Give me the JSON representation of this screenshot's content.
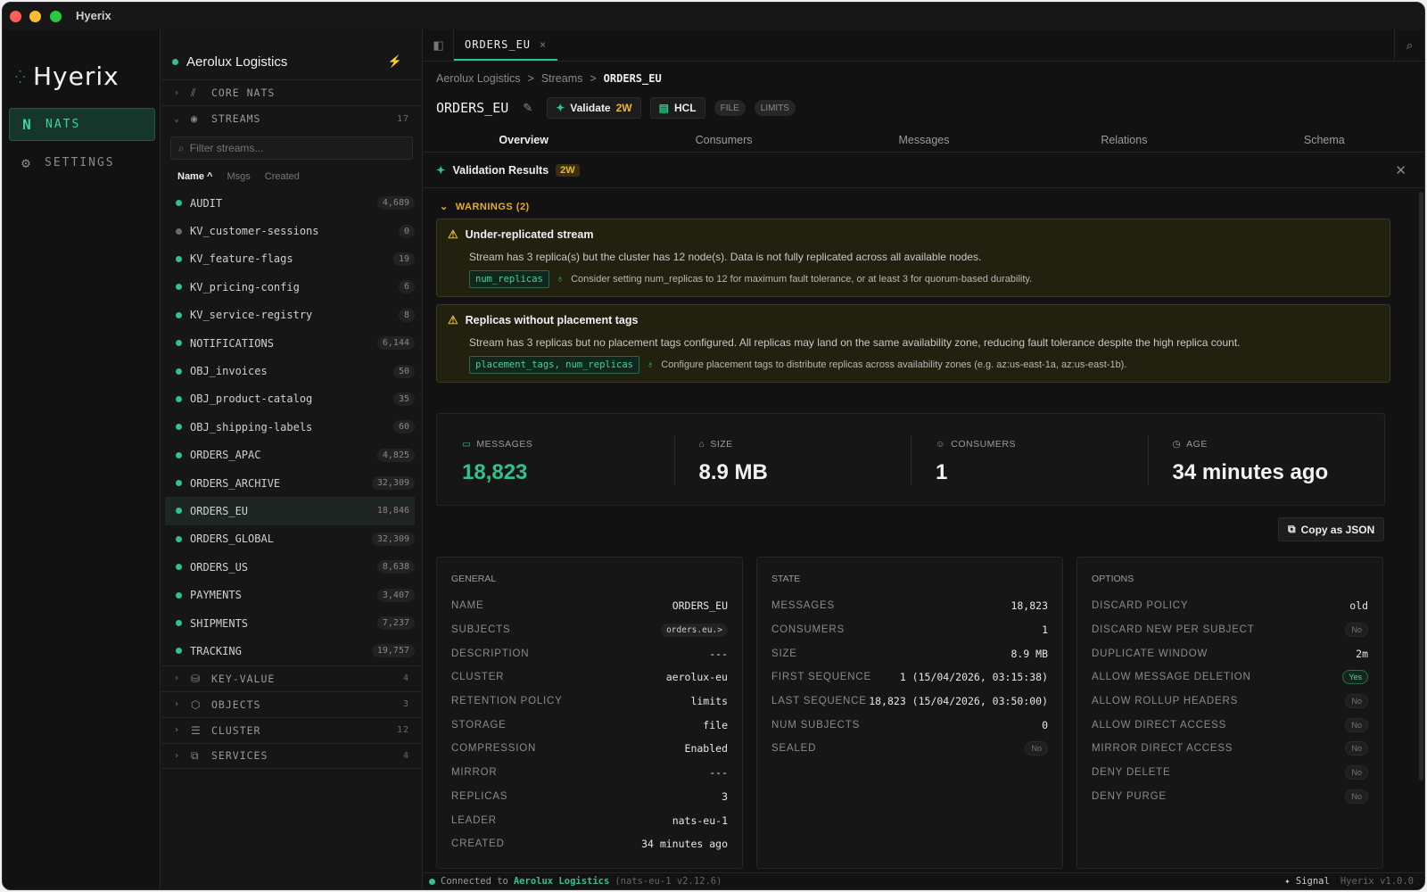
{
  "window": {
    "title": "Hyerix"
  },
  "nav": {
    "logo": "Hyerix",
    "items": [
      {
        "label": "NATS",
        "icon": "nats-n-icon",
        "glyph": "N"
      },
      {
        "label": "SETTINGS",
        "icon": "gear-icon",
        "glyph": "⚙"
      }
    ]
  },
  "sidebar": {
    "connection": "Aerolux Logistics",
    "sections": {
      "core_nats": {
        "label": "CORE NATS"
      },
      "streams": {
        "label": "STREAMS",
        "count": "17"
      },
      "key_value": {
        "label": "KEY-VALUE",
        "count": "4"
      },
      "objects": {
        "label": "OBJECTS",
        "count": "3"
      },
      "cluster": {
        "label": "CLUSTER",
        "count": "12"
      },
      "services": {
        "label": "SERVICES",
        "count": "4"
      }
    },
    "filter_placeholder": "Filter streams...",
    "sort": {
      "name": "Name",
      "msgs": "Msgs",
      "created": "Created",
      "arrow": "^"
    },
    "streams": [
      {
        "name": "AUDIT",
        "count": "4,689",
        "status": "green"
      },
      {
        "name": "KV_customer-sessions",
        "count": "0",
        "status": "grey"
      },
      {
        "name": "KV_feature-flags",
        "count": "19",
        "status": "green"
      },
      {
        "name": "KV_pricing-config",
        "count": "6",
        "status": "green"
      },
      {
        "name": "KV_service-registry",
        "count": "8",
        "status": "green"
      },
      {
        "name": "NOTIFICATIONS",
        "count": "6,144",
        "status": "green"
      },
      {
        "name": "OBJ_invoices",
        "count": "50",
        "status": "green"
      },
      {
        "name": "OBJ_product-catalog",
        "count": "35",
        "status": "green"
      },
      {
        "name": "OBJ_shipping-labels",
        "count": "60",
        "status": "green"
      },
      {
        "name": "ORDERS_APAC",
        "count": "4,825",
        "status": "green"
      },
      {
        "name": "ORDERS_ARCHIVE",
        "count": "32,309",
        "status": "green"
      },
      {
        "name": "ORDERS_EU",
        "count": "18,846",
        "status": "green",
        "selected": true
      },
      {
        "name": "ORDERS_GLOBAL",
        "count": "32,309",
        "status": "green"
      },
      {
        "name": "ORDERS_US",
        "count": "8,638",
        "status": "green"
      },
      {
        "name": "PAYMENTS",
        "count": "3,407",
        "status": "green"
      },
      {
        "name": "SHIPMENTS",
        "count": "7,237",
        "status": "green"
      },
      {
        "name": "TRACKING",
        "count": "19,757",
        "status": "green"
      }
    ]
  },
  "tab": {
    "label": "ORDERS_EU",
    "close": "×"
  },
  "breadcrumb": {
    "root": "Aerolux Logistics",
    "mid": "Streams",
    "current": "ORDERS_EU",
    "sep": ">"
  },
  "header": {
    "title": "ORDERS_EU",
    "validate_label": "Validate",
    "validate_badge": "2W",
    "hcl_label": "HCL",
    "pills": [
      "FILE",
      "LIMITS"
    ]
  },
  "subtabs": [
    "Overview",
    "Consumers",
    "Messages",
    "Relations",
    "Schema"
  ],
  "validation": {
    "title": "Validation Results",
    "badge": "2W",
    "warnings_label": "WARNINGS (2)",
    "warnings": [
      {
        "title": "Under-replicated stream",
        "desc": "Stream has 3 replica(s) but the cluster has 12 node(s). Data is not fully replicated across all available nodes.",
        "fields": "num_replicas",
        "hint": "Consider setting num_replicas to 12 for maximum fault tolerance, or at least 3 for quorum-based durability."
      },
      {
        "title": "Replicas without placement tags",
        "desc": "Stream has 3 replicas but no placement tags configured. All replicas may land on the same availability zone, reducing fault tolerance despite the high replica count.",
        "fields": "placement_tags, num_replicas",
        "hint": "Configure placement tags to distribute replicas across availability zones (e.g. az:us-east-1a, az:us-east-1b)."
      }
    ]
  },
  "stats": [
    {
      "label": "MESSAGES",
      "value": "18,823",
      "icon": "message-icon",
      "glyph": "▭"
    },
    {
      "label": "SIZE",
      "value": "8.9 MB",
      "icon": "disk-icon",
      "glyph": "⌂"
    },
    {
      "label": "CONSUMERS",
      "value": "1",
      "icon": "users-icon",
      "glyph": "☺"
    },
    {
      "label": "AGE",
      "value": "34 minutes ago",
      "icon": "clock-icon",
      "glyph": "◷"
    }
  ],
  "copy_json_label": "Copy as JSON",
  "general": {
    "title": "GENERAL",
    "rows": [
      {
        "k": "NAME",
        "v": "ORDERS_EU"
      },
      {
        "k": "SUBJECTS",
        "v": "orders.eu.>"
      },
      {
        "k": "DESCRIPTION",
        "v": "---"
      },
      {
        "k": "CLUSTER",
        "v": "aerolux-eu"
      },
      {
        "k": "RETENTION POLICY",
        "v": "limits"
      },
      {
        "k": "STORAGE",
        "v": "file"
      },
      {
        "k": "COMPRESSION",
        "v": "Enabled"
      },
      {
        "k": "MIRROR",
        "v": "---"
      },
      {
        "k": "REPLICAS",
        "v": "3"
      },
      {
        "k": "LEADER",
        "v": "nats-eu-1"
      },
      {
        "k": "CREATED",
        "v": "34 minutes ago"
      }
    ]
  },
  "state": {
    "title": "STATE",
    "rows": [
      {
        "k": "MESSAGES",
        "v": "18,823"
      },
      {
        "k": "CONSUMERS",
        "v": "1"
      },
      {
        "k": "SIZE",
        "v": "8.9 MB"
      },
      {
        "k": "FIRST SEQUENCE",
        "v": "1 (15/04/2026, 03:15:38)"
      },
      {
        "k": "LAST SEQUENCE",
        "v": "18,823 (15/04/2026, 03:50:00)"
      },
      {
        "k": "NUM SUBJECTS",
        "v": "0"
      },
      {
        "k": "SEALED",
        "v": "No"
      }
    ]
  },
  "options": {
    "title": "OPTIONS",
    "rows": [
      {
        "k": "DISCARD POLICY",
        "v": "old"
      },
      {
        "k": "DISCARD NEW PER SUBJECT",
        "v": "No"
      },
      {
        "k": "DUPLICATE WINDOW",
        "v": "2m"
      },
      {
        "k": "ALLOW MESSAGE DELETION",
        "v": "Yes"
      },
      {
        "k": "ALLOW ROLLUP HEADERS",
        "v": "No"
      },
      {
        "k": "ALLOW DIRECT ACCESS",
        "v": "No"
      },
      {
        "k": "MIRROR DIRECT ACCESS",
        "v": "No"
      },
      {
        "k": "DENY DELETE",
        "v": "No"
      },
      {
        "k": "DENY PURGE",
        "v": "No"
      }
    ]
  },
  "status": {
    "prefix": "Connected to",
    "server": "Aerolux Logistics",
    "detail": "(nats-eu-1 v2.12.6)",
    "signal": "Signal",
    "version": "Hyerix v1.0.0"
  },
  "colors": {
    "accent": "#2fc28b",
    "warning": "#e8b730",
    "background": "#121212"
  }
}
